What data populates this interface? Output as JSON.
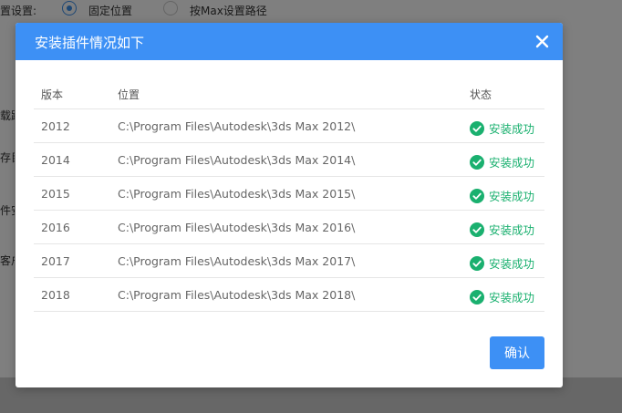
{
  "background": {
    "setting_label": "置设置:",
    "option_fixed": "固定位置",
    "option_max_path": "按Max设置路径",
    "side_fragments": [
      "载路",
      "存目",
      "件安",
      "客户"
    ]
  },
  "dialog": {
    "title": "安装插件情况如下",
    "close_icon": "close-icon",
    "columns": {
      "version": "版本",
      "location": "位置",
      "status": "状态"
    },
    "rows": [
      {
        "version": "2012",
        "location": "C:\\Program Files\\Autodesk\\3ds Max 2012\\",
        "status": "安装成功"
      },
      {
        "version": "2014",
        "location": "C:\\Program Files\\Autodesk\\3ds Max 2014\\",
        "status": "安装成功"
      },
      {
        "version": "2015",
        "location": "C:\\Program Files\\Autodesk\\3ds Max 2015\\",
        "status": "安装成功"
      },
      {
        "version": "2016",
        "location": "C:\\Program Files\\Autodesk\\3ds Max 2016\\",
        "status": "安装成功"
      },
      {
        "version": "2017",
        "location": "C:\\Program Files\\Autodesk\\3ds Max 2017\\",
        "status": "安装成功"
      },
      {
        "version": "2018",
        "location": "C:\\Program Files\\Autodesk\\3ds Max 2018\\",
        "status": "安装成功"
      }
    ],
    "confirm_label": "确认"
  },
  "colors": {
    "primary": "#3d90f5",
    "success": "#1ab06f",
    "overlay": "rgba(0,0,0,0.5)"
  }
}
